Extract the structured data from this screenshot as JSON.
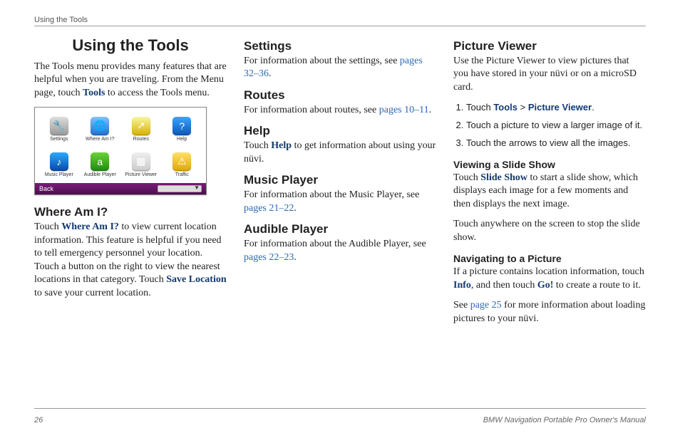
{
  "running_head": "Using the Tools",
  "page_number": "26",
  "footer_right": "BMW Navigation Portable Pro Owner's Manual",
  "title": "Using the Tools",
  "intro": {
    "pre": "The Tools menu provides many features that are helpful when you are traveling. From the Menu page, touch ",
    "term": "Tools",
    "post": " to access the Tools menu."
  },
  "device": {
    "apps": [
      {
        "icon": "🔧",
        "label": "Settings",
        "cls": "ic-settings",
        "name": "tool-settings-icon"
      },
      {
        "icon": "🌐",
        "label": "Where Am I?",
        "cls": "ic-where",
        "name": "tool-where-am-i-icon"
      },
      {
        "icon": "↗",
        "label": "Routes",
        "cls": "ic-routes",
        "name": "tool-routes-icon"
      },
      {
        "icon": "?",
        "label": "Help",
        "cls": "ic-help",
        "name": "tool-help-icon"
      },
      {
        "icon": "♪",
        "label": "Music Player",
        "cls": "ic-music",
        "name": "tool-music-player-icon"
      },
      {
        "icon": "a",
        "label": "Audible Player",
        "cls": "ic-audible",
        "name": "tool-audible-player-icon"
      },
      {
        "icon": "▦",
        "label": "Picture Viewer",
        "cls": "ic-picture",
        "name": "tool-picture-viewer-icon"
      },
      {
        "icon": "⚠",
        "label": "Traffic",
        "cls": "ic-traffic",
        "name": "tool-traffic-icon"
      }
    ],
    "back_label": "Back"
  },
  "where": {
    "heading": "Where Am I?",
    "p1a": "Touch ",
    "p1term": "Where Am I?",
    "p1b": " to view current location information. This feature is helpful if you need to tell emergency personnel your location. Touch a button on the right to view the nearest locations in that category. Touch ",
    "p1term2": "Save Location",
    "p1c": " to save your current location."
  },
  "settings": {
    "heading": "Settings",
    "p": "For information about the settings, see ",
    "link": "pages 32–36",
    "post": "."
  },
  "routes": {
    "heading": "Routes",
    "p": "For information about routes, see ",
    "link": "pages 10–11",
    "post": "."
  },
  "help": {
    "heading": "Help",
    "pa": "Touch ",
    "term": "Help",
    "pb": " to get information about using your nüvi."
  },
  "music": {
    "heading": "Music Player",
    "p": "For information about the Music Player, see ",
    "link": "pages 21–22",
    "post": "."
  },
  "audible": {
    "heading": "Audible Player",
    "p": "For information about the Audible Player, see ",
    "link": "pages 22–23",
    "post": "."
  },
  "pic": {
    "heading": "Picture Viewer",
    "intro": "Use the Picture Viewer to view pictures that you have stored in your nüvi or on a microSD card.",
    "step1a": "Touch ",
    "step1_t1": "Tools",
    "step1_gt": " > ",
    "step1_t2": "Picture Viewer",
    "step1b": ".",
    "step2": "Touch a picture to view a larger image of it.",
    "step3": "Touch the arrows to view all the images.",
    "slide_heading": "Viewing a Slide Show",
    "slide_p1a": "Touch ",
    "slide_term": "Slide Show",
    "slide_p1b": " to start a slide show, which displays each image for a few moments and then displays the next image.",
    "slide_p2": "Touch anywhere on the screen to stop the slide show.",
    "nav_heading": "Navigating to a Picture",
    "nav_p1a": "If a picture contains location information, touch ",
    "nav_t1": "Info",
    "nav_p1b": ", and then touch ",
    "nav_t2": "Go!",
    "nav_p1c": " to create a route to it.",
    "nav_p2a": "See ",
    "nav_link": "page 25",
    "nav_p2b": " for more information about loading pictures to your nüvi."
  }
}
